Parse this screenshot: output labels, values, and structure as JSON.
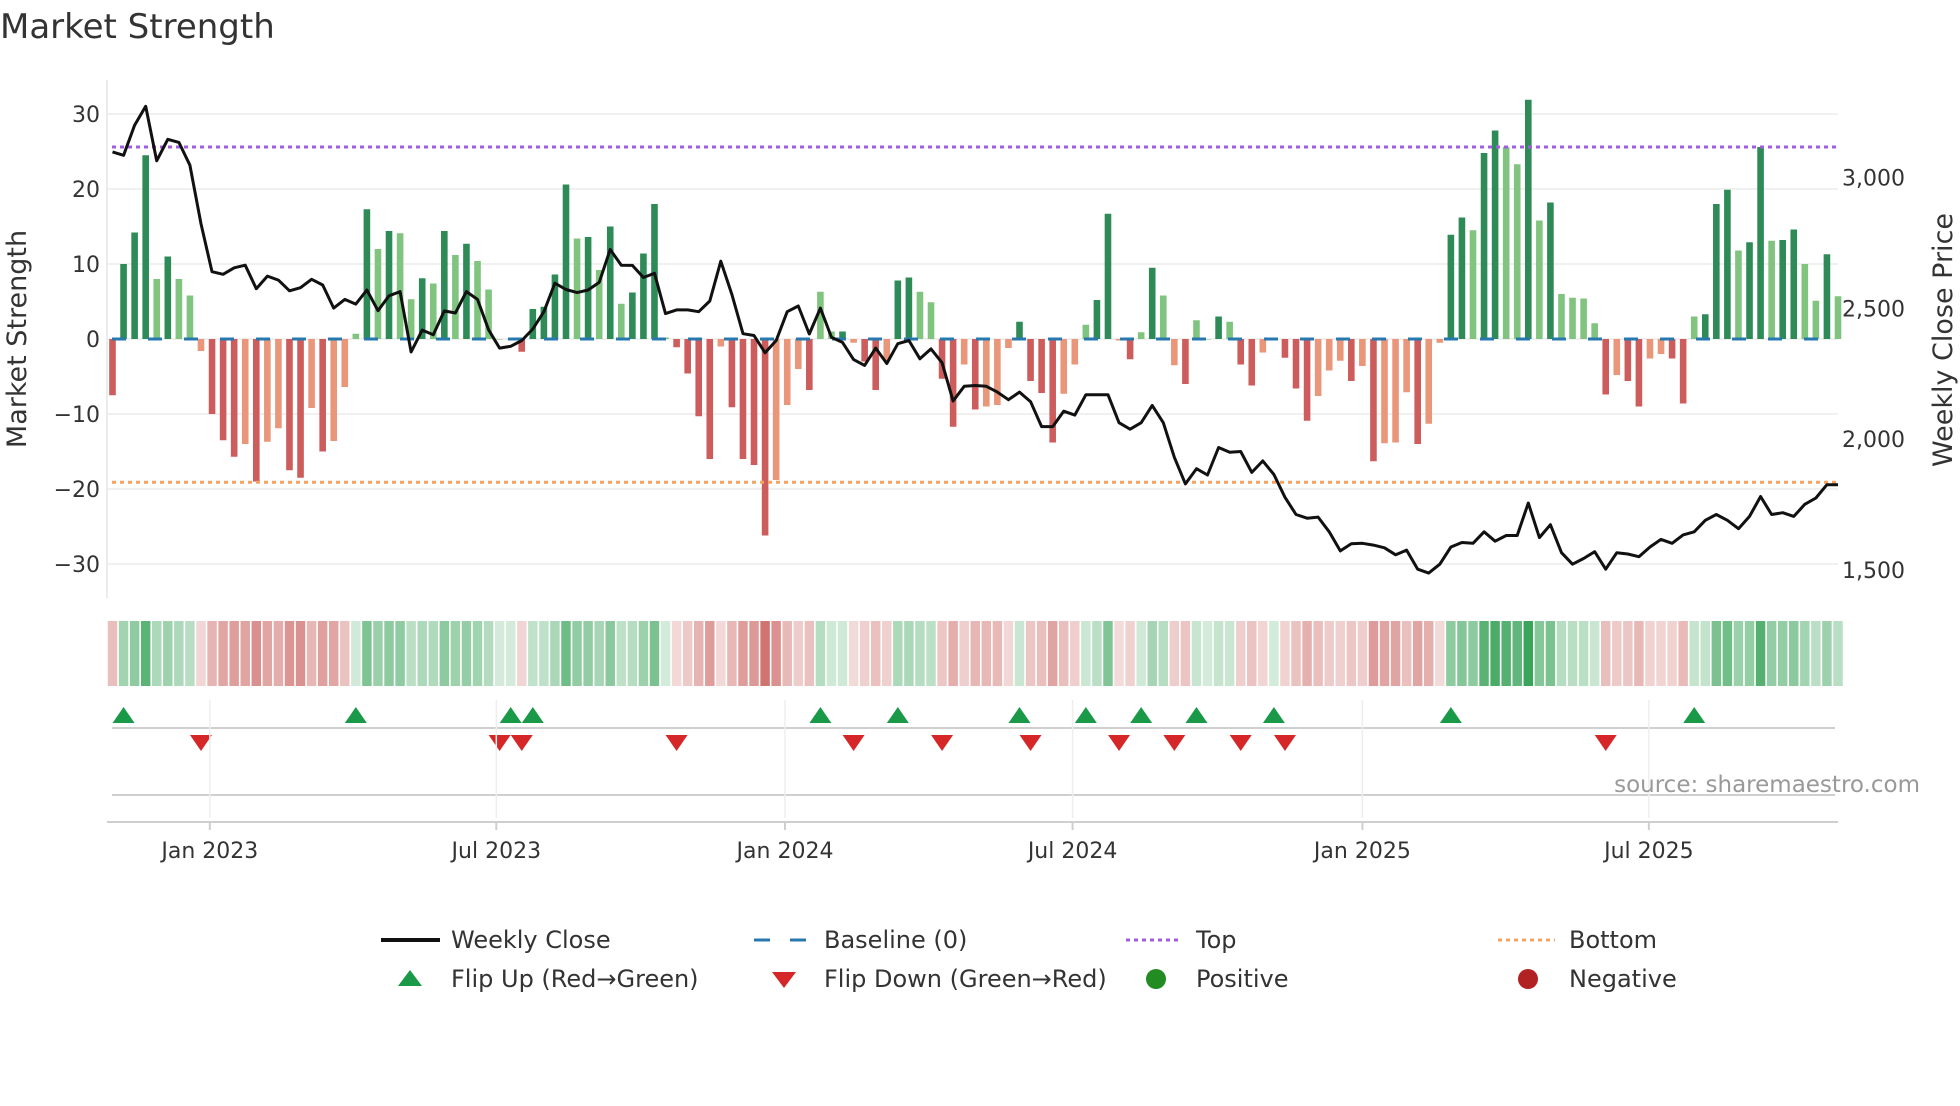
{
  "title": "Market Strength",
  "source": "source: sharemaestro.com",
  "colors": {
    "pos_strong": "#2e8b57",
    "pos_weak": "#80c47f",
    "neg_strong": "#cd5c5c",
    "neg_weak": "#e9967a",
    "price": "#111111",
    "baseline": "#2878b0",
    "top": "#a05de0",
    "bottom": "#f4a460",
    "flip_up": "#1a9a48",
    "flip_down": "#d62728",
    "positive": "#228b22",
    "negative": "#b22222",
    "heat_pos": "#3aa45a",
    "heat_neg": "#c9605c"
  },
  "legend": {
    "weekly_close": "Weekly Close",
    "baseline": "Baseline (0)",
    "top": "Top",
    "bottom": "Bottom",
    "flip_up": "Flip Up (Red→Green)",
    "flip_down": "Flip Down (Green→Red)",
    "positive": "Positive",
    "negative": "Negative"
  },
  "chart_data": {
    "type": "bar",
    "title": "Market Strength",
    "ylabel": "Market Strength",
    "y2label": "Weekly Close Price",
    "ylim": [
      -35,
      35
    ],
    "y2lim": [
      1300,
      3350
    ],
    "yticks": [
      30,
      20,
      10,
      0,
      -10,
      -20,
      -30
    ],
    "y2ticks": [
      {
        "v": 3000,
        "label": "3,000"
      },
      {
        "v": 2500,
        "label": "2,500"
      },
      {
        "v": 2000,
        "label": "2,000"
      },
      {
        "v": 1500,
        "label": "1,500"
      }
    ],
    "xticks": [
      {
        "week": 8.8,
        "label": "Jan 2023"
      },
      {
        "week": 34.7,
        "label": "Jul 2023"
      },
      {
        "week": 60.8,
        "label": "Jan 2024"
      },
      {
        "week": 86.8,
        "label": "Jul 2024"
      },
      {
        "week": 113,
        "label": "Jan 2025"
      },
      {
        "week": 138.9,
        "label": "Jul 2025"
      }
    ],
    "top_level": 25.6,
    "bottom_level": -19.1,
    "baseline": 0,
    "strength": [
      -7.5,
      10,
      14.2,
      24.5,
      8,
      11,
      8,
      5.8,
      -1.6,
      -10,
      -13.5,
      -15.7,
      -14,
      -19,
      -13.7,
      -11.9,
      -17.5,
      -18.5,
      -9.2,
      -15,
      -13.6,
      -6.4,
      0.7,
      17.3,
      12,
      14.4,
      14.1,
      5.3,
      8.1,
      7.4,
      14.4,
      11.2,
      12.7,
      10.4,
      6.6,
      0,
      0,
      -1.7,
      4,
      4.3,
      8.6,
      20.6,
      13.4,
      13.6,
      9.2,
      15,
      4.7,
      6.2,
      11.4,
      18,
      0.2,
      -1.1,
      -4.6,
      -10.3,
      -16,
      -1,
      -9.1,
      -16,
      -16.8,
      -26.2,
      -18.8,
      -8.8,
      -4,
      -6.8,
      6.3,
      1,
      1,
      -0.5,
      -3,
      -6.8,
      -3,
      7.8,
      8.2,
      6.3,
      4.9,
      -5.3,
      -11.7,
      -3.4,
      -9.4,
      -9,
      -8.8,
      -1.2,
      2.3,
      -5.6,
      -7.2,
      -13.8,
      -7.3,
      -3.4,
      1.9,
      5.2,
      16.7,
      -0.2,
      -2.7,
      0.9,
      9.5,
      5.8,
      -3.5,
      -6,
      2.5,
      0,
      3,
      2.3,
      -3.4,
      -6.2,
      -1.8,
      0.2,
      -2.5,
      -6.6,
      -10.9,
      -7.6,
      -4.2,
      -2.9,
      -5.6,
      -3.6,
      -16.3,
      -13.9,
      -13.8,
      -7.1,
      -14,
      -11.3,
      -0.5,
      13.9,
      16.2,
      14.5,
      24.8,
      27.8,
      25.6,
      23.3,
      31.9,
      15.8,
      18.2,
      6,
      5.5,
      5.4,
      2.1,
      -7.4,
      -4.8,
      -5.6,
      -9,
      -2.6,
      -2,
      -2.6,
      -8.6,
      3,
      3.3,
      18,
      19.9,
      11.8,
      12.9,
      25.6,
      13.1,
      13.2,
      14.6,
      10,
      5.1,
      11.3,
      5.7
    ],
    "weekly_close": [
      3098,
      3085,
      3200,
      3272,
      3064,
      3146,
      3134,
      3047,
      2823,
      2640,
      2630,
      2655,
      2665,
      2575,
      2623,
      2608,
      2567,
      2579,
      2611,
      2589,
      2501,
      2534,
      2516,
      2570,
      2491,
      2548,
      2564,
      2333,
      2417,
      2399,
      2490,
      2482,
      2564,
      2534,
      2418,
      2348,
      2355,
      2377,
      2421,
      2487,
      2596,
      2572,
      2560,
      2570,
      2599,
      2725,
      2665,
      2664,
      2618,
      2634,
      2480,
      2494,
      2494,
      2487,
      2528,
      2680,
      2553,
      2403,
      2396,
      2330,
      2377,
      2487,
      2509,
      2402,
      2501,
      2389,
      2370,
      2304,
      2282,
      2348,
      2289,
      2365,
      2377,
      2307,
      2345,
      2292,
      2146,
      2202,
      2205,
      2202,
      2180,
      2151,
      2180,
      2143,
      2048,
      2048,
      2107,
      2092,
      2170,
      2170,
      2170,
      2063,
      2038,
      2063,
      2129,
      2063,
      1931,
      1829,
      1887,
      1863,
      1968,
      1950,
      1953,
      1873,
      1917,
      1865,
      1778,
      1712,
      1698,
      1702,
      1646,
      1573,
      1600,
      1602,
      1595,
      1585,
      1558,
      1576,
      1503,
      1488,
      1522,
      1588,
      1605,
      1602,
      1646,
      1610,
      1632,
      1632,
      1756,
      1624,
      1673,
      1566,
      1522,
      1544,
      1570,
      1503,
      1566,
      1561,
      1551,
      1588,
      1617,
      1602,
      1634,
      1646,
      1690,
      1712,
      1690,
      1658,
      1705,
      1781,
      1712,
      1719,
      1705,
      1751,
      1775,
      1826,
      1826
    ],
    "flip_up_weeks": [
      1,
      22,
      36,
      38,
      64,
      71,
      82,
      88,
      93,
      98,
      105,
      121,
      143
    ],
    "flip_down_weeks": [
      8,
      35,
      37,
      51,
      67,
      75,
      83,
      91,
      96,
      102,
      106,
      135
    ],
    "grid": true,
    "legend_position": "bottom"
  }
}
